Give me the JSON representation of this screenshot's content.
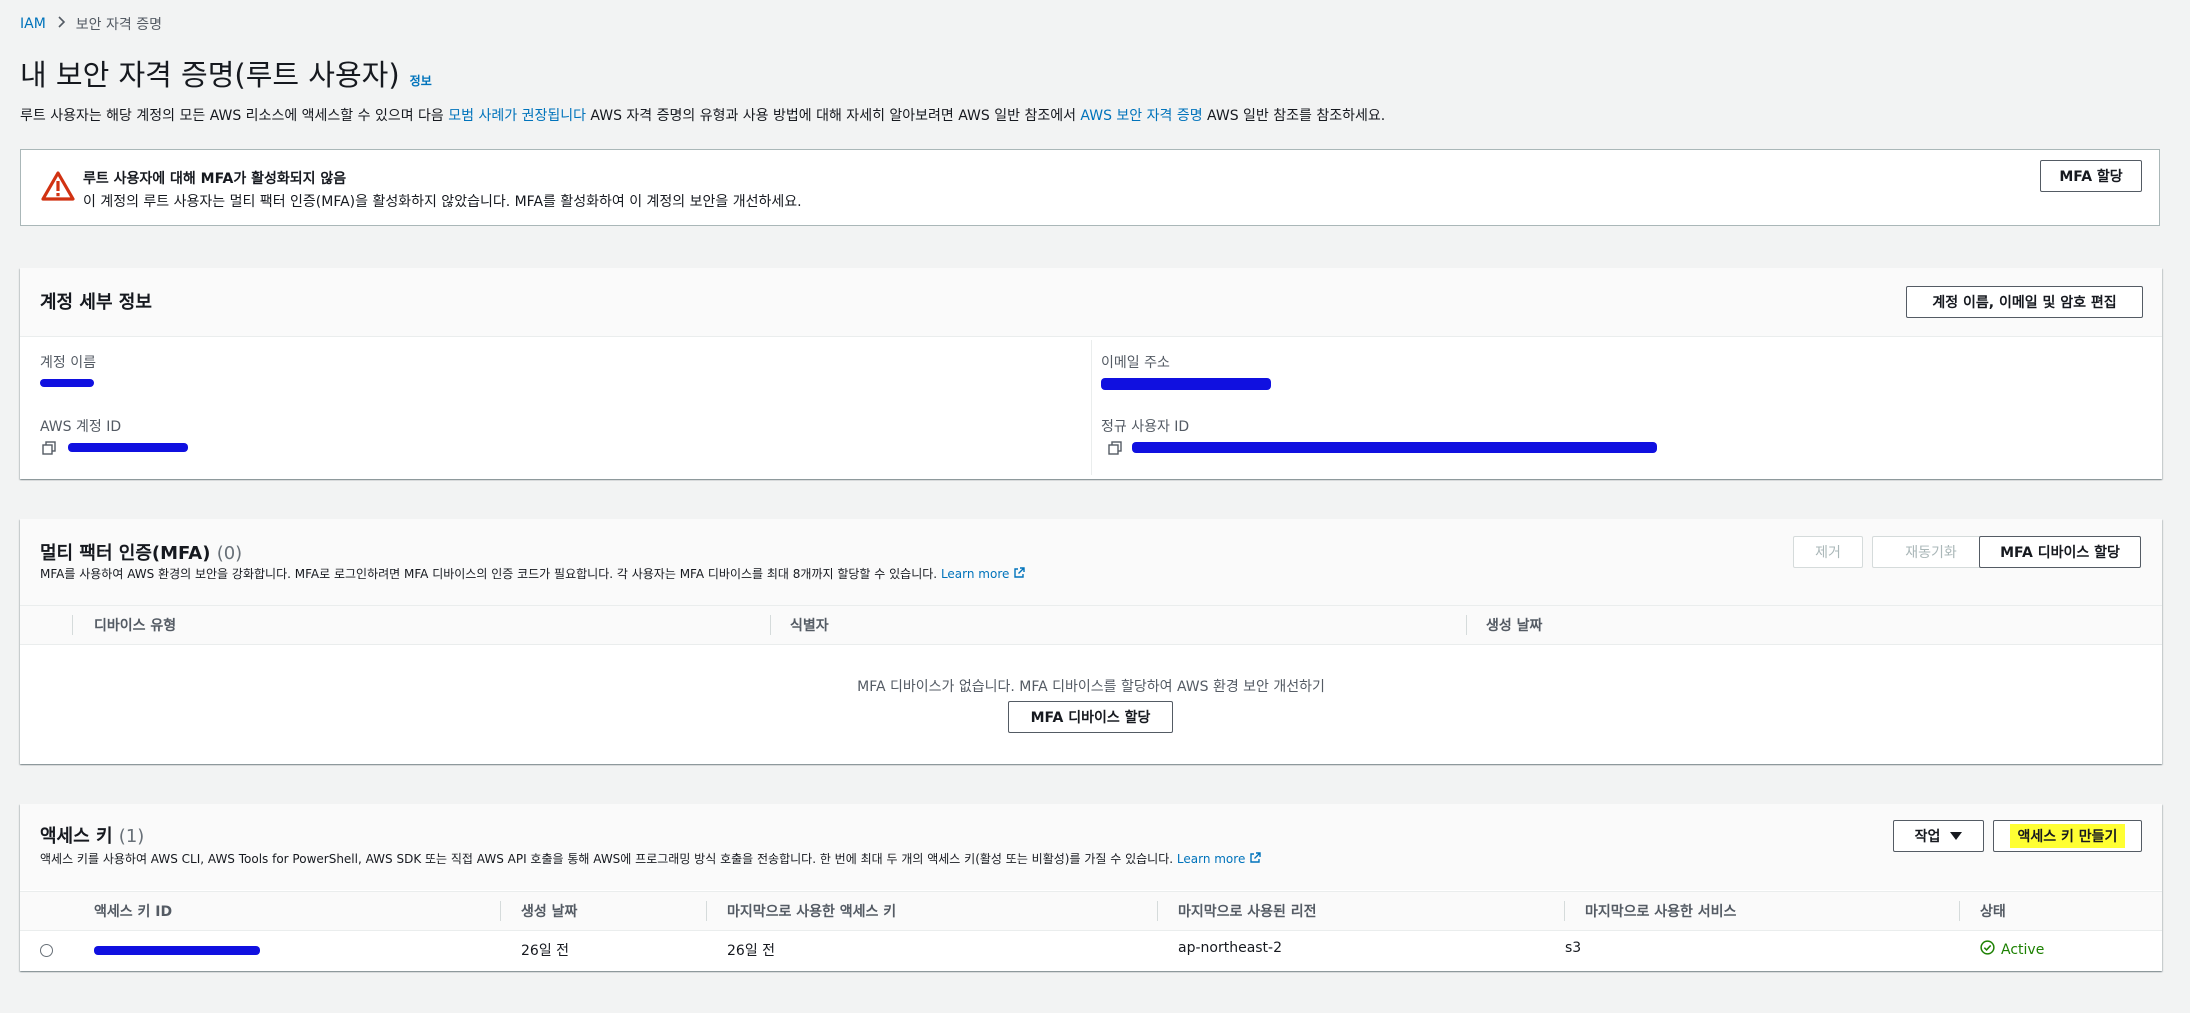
{
  "breadcrumb": {
    "root": "IAM",
    "current": "보안 자격 증명"
  },
  "page": {
    "title": "내 보안 자격 증명(루트 사용자)",
    "info": "정보",
    "desc_1": "루트 사용자는 해당 계정의 모든 AWS 리소스에 액세스할 수 있으며 다음 ",
    "desc_link1": "모범 사례가 권장됩니다",
    "desc_2": " AWS 자격 증명의 유형과 사용 방법에 대해 자세히 알아보려면 AWS 일반 참조에서 ",
    "desc_link2": "AWS 보안 자격 증명",
    "desc_3": " AWS 일반 참조를 참조하세요."
  },
  "alert": {
    "title": "루트 사용자에 대해 MFA가 활성화되지 않음",
    "body": "이 계정의 루트 사용자는 멀티 팩터 인증(MFA)을 활성화하지 않았습니다. MFA를 활성화하여 이 계정의 보안을 개선하세요.",
    "button": "MFA 할당"
  },
  "account": {
    "title": "계정 세부 정보",
    "edit_button": "계정 이름, 이메일 및 암호 편집",
    "name_label": "계정 이름",
    "email_label": "이메일 주소",
    "id_label": "AWS 계정 ID",
    "canonical_label": "정규 사용자 ID"
  },
  "mfa": {
    "title": "멀티 팩터 인증(MFA)",
    "count": "(0)",
    "sub": "MFA를 사용하여 AWS 환경의 보안을 강화합니다. MFA로 로그인하려면 MFA 디바이스의 인증 코드가 필요합니다. 각 사용자는 MFA 디바이스를 최대 8개까지 할당할 수 있습니다.",
    "learn_more": "Learn more",
    "remove": "제거",
    "resync": "재동기화",
    "assign": "MFA 디바이스 할당",
    "columns": [
      "디바이스 유형",
      "식별자",
      "생성 날짜"
    ],
    "empty": "MFA 디바이스가 없습니다. MFA 디바이스를 할당하여 AWS 환경 보안 개선하기",
    "empty_button": "MFA 디바이스 할당"
  },
  "keys": {
    "title": "액세스 키",
    "count": "(1)",
    "sub": "액세스 키를 사용하여 AWS CLI, AWS Tools for PowerShell, AWS SDK 또는 직접 AWS API 호출을 통해 AWS에 프로그래밍 방식 호출을 전송합니다. 한 번에 최대 두 개의 액세스 키(활성 또는 비활성)를 가질 수 있습니다.",
    "learn_more": "Learn more",
    "actions": "작업",
    "create": "액세스 키 만들기",
    "columns": [
      "액세스 키 ID",
      "생성 날짜",
      "마지막으로 사용한 액세스 키",
      "마지막으로 사용된 리전",
      "마지막으로 사용한 서비스",
      "상태"
    ],
    "rows": [
      {
        "created": "26일 전",
        "last_used": "26일 전",
        "region": "ap-northeast-2",
        "service": "s3",
        "status": "Active"
      }
    ]
  },
  "colors": {
    "link": "#0073bb",
    "warning": "#d13212",
    "active": "#1d8102",
    "redaction": "#1010e0",
    "highlight": "#ffff33"
  }
}
